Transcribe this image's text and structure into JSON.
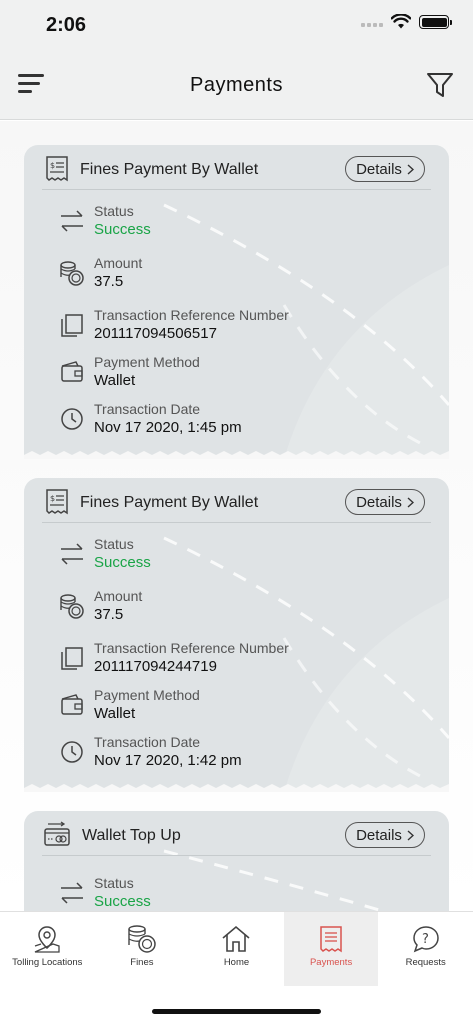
{
  "status_bar": {
    "time": "2:06"
  },
  "header": {
    "title": "Payments"
  },
  "colors": {
    "success": "#1aa447",
    "active_nav": "#d9534f",
    "card_bg": "#dfe3e5"
  },
  "cards": [
    {
      "title": "Fines Payment By Wallet",
      "icon": "receipt-icon",
      "details_label": "Details",
      "rows": [
        {
          "icon": "transfer-arrows-icon",
          "label": "Status",
          "value": "Success"
        },
        {
          "icon": "coins-icon",
          "label": "Amount",
          "value": "37.5"
        },
        {
          "icon": "copy-icon",
          "label": "Transaction Reference Number",
          "value": "201117094506517"
        },
        {
          "icon": "wallet-icon",
          "label": "Payment Method",
          "value": "Wallet"
        },
        {
          "icon": "clock-icon",
          "label": "Transaction Date",
          "value": "Nov 17 2020, 1:45 pm"
        }
      ]
    },
    {
      "title": "Fines Payment By Wallet",
      "icon": "receipt-icon",
      "details_label": "Details",
      "rows": [
        {
          "icon": "transfer-arrows-icon",
          "label": "Status",
          "value": "Success"
        },
        {
          "icon": "coins-icon",
          "label": "Amount",
          "value": "37.5"
        },
        {
          "icon": "copy-icon",
          "label": "Transaction Reference Number",
          "value": "201117094244719"
        },
        {
          "icon": "wallet-icon",
          "label": "Payment Method",
          "value": "Wallet"
        },
        {
          "icon": "clock-icon",
          "label": "Transaction Date",
          "value": "Nov 17 2020, 1:42 pm"
        }
      ]
    },
    {
      "title": "Wallet Top Up",
      "icon": "card-topup-icon",
      "details_label": "Details",
      "rows": [
        {
          "icon": "transfer-arrows-icon",
          "label": "Status",
          "value": "Success"
        }
      ]
    }
  ],
  "nav": [
    {
      "label": "Tolling Locations",
      "icon": "location-pin-icon"
    },
    {
      "label": "Fines",
      "icon": "coins-icon"
    },
    {
      "label": "Home",
      "icon": "home-icon"
    },
    {
      "label": "Payments",
      "icon": "receipt-icon",
      "active": true
    },
    {
      "label": "Requests",
      "icon": "question-chat-icon"
    }
  ]
}
